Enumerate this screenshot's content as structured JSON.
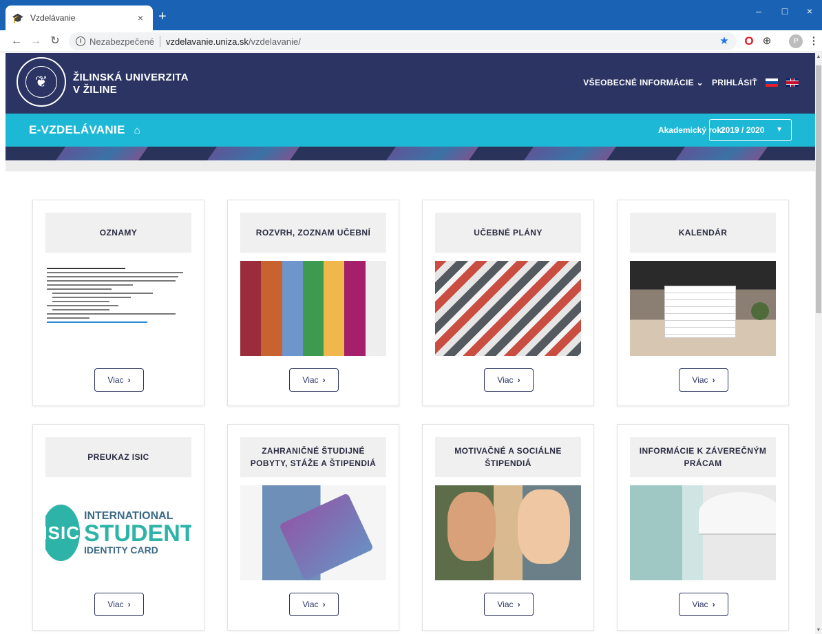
{
  "browser": {
    "tab_title": "Vzdelávanie",
    "tab_close": "×",
    "new_tab": "+",
    "window_controls": {
      "minimize": "–",
      "maximize": "□",
      "close": "×"
    },
    "insecure_label": "Nezabezpečené",
    "url_domain": "vzdelavanie.uniza.sk",
    "url_path": "/vzdelavanie/",
    "avatar_letter": "P",
    "icons": [
      "back-icon",
      "forward-icon",
      "reload-icon",
      "info-icon",
      "star-icon",
      "opera-icon",
      "extension-icon",
      "avatar-icon",
      "menu-icon"
    ]
  },
  "header": {
    "university_line1": "ŽILINSKÁ UNIVERZITA",
    "university_line2": "V ŽILINE",
    "nav_general": "VŠEOBECNÉ INFORMÁCIE",
    "nav_login": "PRIHLÁSIŤ",
    "flags": [
      "sk",
      "en"
    ],
    "colors": {
      "primary": "#2b3463",
      "secondary": "#1db8d6"
    }
  },
  "subheader": {
    "title": "E-VZDELÁVANIE",
    "year_label": "Akademický rok:",
    "year_value": "2019 / 2020"
  },
  "cards": [
    {
      "title": "OZNAMY",
      "button": "Viac"
    },
    {
      "title": "ROZVRH, ZOZNAM UČEBNÍ",
      "button": "Viac"
    },
    {
      "title": "UČEBNÉ PLÁNY",
      "button": "Viac"
    },
    {
      "title": "KALENDÁR",
      "button": "Viac"
    },
    {
      "title": "PREUKAZ ISIC",
      "button": "Viac",
      "image_text": {
        "circle": "ISIC",
        "line1": "INTERNATIONAL",
        "line2": "STUDENT",
        "line3": "IDENTITY CARD"
      }
    },
    {
      "title": "ZAHRANIČNÉ ŠTUDIJNÉ POBYTY, STÁŽE A ŠTIPENDIÁ",
      "button": "Viac"
    },
    {
      "title": "MOTIVAČNÉ A SOCIÁLNE ŠTIPENDIÁ",
      "button": "Viac"
    },
    {
      "title": "INFORMÁCIE K ZÁVEREČNÝM PRÁCAM",
      "button": "Viac"
    }
  ]
}
